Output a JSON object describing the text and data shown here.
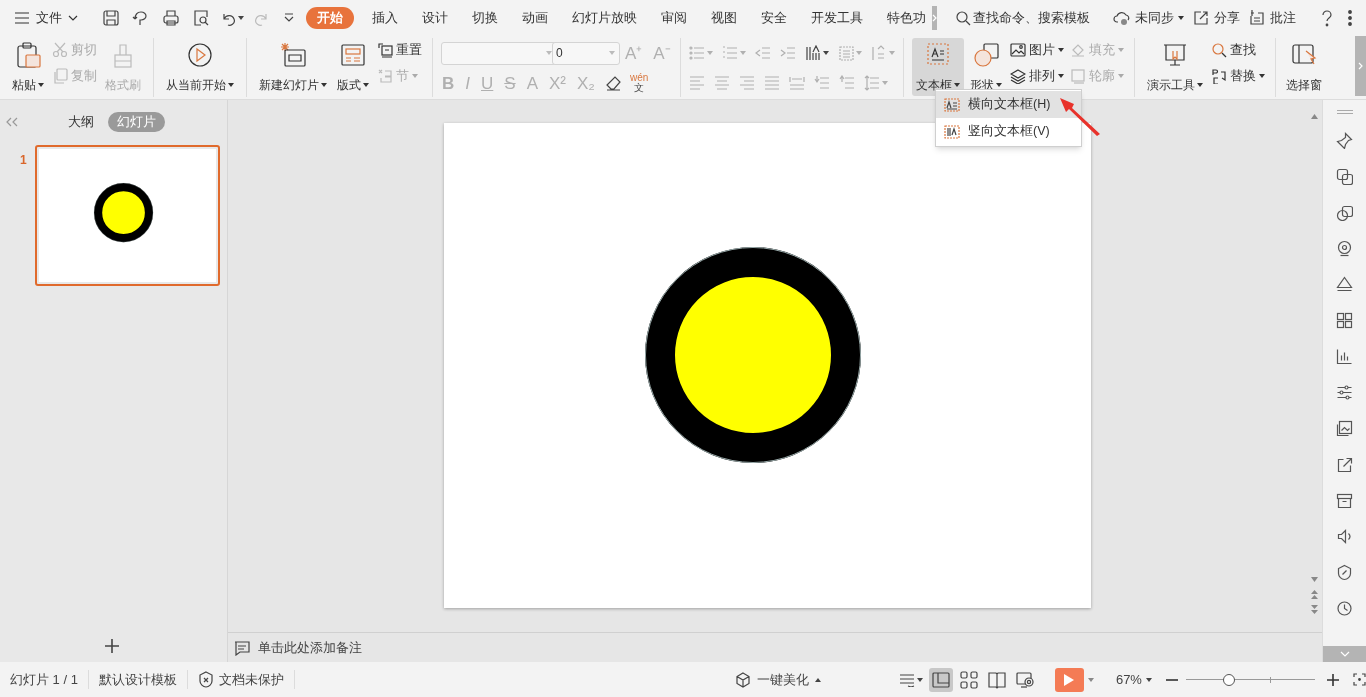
{
  "title_bar": {
    "file_menu": "文件",
    "tabs": [
      {
        "label": "开始",
        "selected": true
      },
      {
        "label": "插入",
        "selected": false
      },
      {
        "label": "设计",
        "selected": false
      },
      {
        "label": "切换",
        "selected": false
      },
      {
        "label": "动画",
        "selected": false
      },
      {
        "label": "幻灯片放映",
        "selected": false
      },
      {
        "label": "审阅",
        "selected": false
      },
      {
        "label": "视图",
        "selected": false
      },
      {
        "label": "安全",
        "selected": false
      },
      {
        "label": "开发工具",
        "selected": false
      },
      {
        "label": "特色功",
        "selected": false
      }
    ],
    "search": {
      "placeholder": "查找命令、搜索模板"
    },
    "actions": [
      {
        "label": "未同步",
        "dropdown": true
      },
      {
        "label": "分享",
        "dropdown": false
      },
      {
        "label": "批注",
        "dropdown": false
      }
    ]
  },
  "ribbon": {
    "groups": [
      {
        "items": [
          {
            "kind": "large",
            "label": "粘贴",
            "dropdown": true,
            "disabled": false,
            "pressed": false
          },
          {
            "kind": "small",
            "label": "剪切",
            "dropdown": false,
            "disabled": true,
            "pressed": false
          },
          {
            "kind": "small",
            "label": "复制",
            "dropdown": false,
            "disabled": true,
            "pressed": false
          },
          {
            "kind": "large",
            "label": "格式刷",
            "dropdown": false,
            "disabled": true,
            "pressed": false
          }
        ]
      },
      {
        "items": [
          {
            "kind": "large",
            "label": "从当前开始",
            "dropdown": true,
            "disabled": false,
            "pressed": false
          }
        ]
      },
      {
        "items": [
          {
            "kind": "large",
            "label": "新建幻灯片",
            "dropdown": true,
            "disabled": false,
            "pressed": false
          },
          {
            "kind": "large",
            "label": "版式",
            "dropdown": true,
            "disabled": false,
            "pressed": false
          },
          {
            "kind": "small",
            "label": "重置",
            "dropdown": false,
            "disabled": false,
            "pressed": false
          },
          {
            "kind": "small",
            "label": "节",
            "dropdown": true,
            "disabled": true,
            "pressed": false
          }
        ]
      },
      {
        "top_line": [
          {
            "kind": "field"
          },
          {
            "kind": "field",
            "value": "0"
          },
          {
            "kind": "glyph",
            "label": "A⁺",
            "disabled": true
          },
          {
            "kind": "glyph",
            "label": "A⁻",
            "disabled": true
          }
        ],
        "bottom_line": [
          {
            "kind": "glyph",
            "label": "B",
            "disabled": true
          },
          {
            "kind": "glyph",
            "label": "I",
            "disabled": true
          },
          {
            "kind": "glyph",
            "label": "U",
            "disabled": true
          },
          {
            "kind": "glyph",
            "label": "S",
            "disabled": true
          },
          {
            "kind": "glyph",
            "label": "A",
            "disabled": true
          },
          {
            "kind": "glyph",
            "label": "X²",
            "disabled": true
          },
          {
            "kind": "glyph",
            "label": "X₂",
            "disabled": true
          },
          {
            "kind": "icon",
            "disabled": false
          },
          {
            "kind": "phonetic",
            "ruby": "wén",
            "base": "文",
            "disabled": false
          }
        ]
      },
      {
        "top_line": [
          {
            "kind": "icon",
            "disabled": true
          },
          {
            "kind": "icon",
            "disabled": true
          },
          {
            "kind": "icon",
            "disabled": true
          },
          {
            "kind": "icon",
            "disabled": true
          },
          {
            "kind": "icon",
            "disabled": false
          },
          {
            "kind": "icon",
            "disabled": true
          },
          {
            "kind": "icon",
            "disabled": true
          }
        ],
        "bottom_line": [
          {
            "kind": "icon",
            "disabled": true
          },
          {
            "kind": "icon",
            "disabled": true
          },
          {
            "kind": "icon",
            "disabled": true
          },
          {
            "kind": "icon",
            "disabled": true
          },
          {
            "kind": "icon",
            "disabled": true
          },
          {
            "kind": "icon",
            "disabled": true
          },
          {
            "kind": "icon",
            "disabled": true
          },
          {
            "kind": "icon",
            "disabled": true
          }
        ]
      },
      {
        "items": [
          {
            "kind": "large",
            "label": "文本框",
            "dropdown": true,
            "disabled": false,
            "pressed": true
          },
          {
            "kind": "large",
            "label": "形状",
            "dropdown": true,
            "disabled": false,
            "pressed": false
          },
          {
            "kind": "small",
            "label": "图片",
            "dropdown": true,
            "disabled": false,
            "pressed": false
          },
          {
            "kind": "small",
            "label": "排列",
            "dropdown": true,
            "disabled": false,
            "pressed": false
          },
          {
            "kind": "small",
            "label": "填充",
            "dropdown": true,
            "disabled": true,
            "pressed": false
          },
          {
            "kind": "small",
            "label": "轮廓",
            "dropdown": true,
            "disabled": true,
            "pressed": false
          }
        ]
      },
      {
        "items": [
          {
            "kind": "large",
            "label": "演示工具",
            "dropdown": true,
            "disabled": false,
            "pressed": false
          },
          {
            "kind": "small",
            "label": "查找",
            "dropdown": false,
            "disabled": false,
            "pressed": false
          },
          {
            "kind": "small",
            "label": "替换",
            "dropdown": true,
            "disabled": false,
            "pressed": false
          }
        ]
      },
      {
        "items": [
          {
            "kind": "large",
            "label": "选择窗",
            "dropdown": false,
            "disabled": false,
            "pressed": false
          }
        ]
      }
    ]
  },
  "text_box_menu": {
    "items": [
      {
        "label": "横向文本框(H)",
        "selected": true
      },
      {
        "label": "竖向文本框(V)",
        "selected": false
      }
    ]
  },
  "side_panel": {
    "tabs": [
      {
        "label": "大纲",
        "selected": false
      },
      {
        "label": "幻灯片",
        "selected": true
      }
    ],
    "slides": [
      {
        "number": "1",
        "selected": true
      }
    ]
  },
  "notes": {
    "placeholder": "单击此处添加备注"
  },
  "status_bar": {
    "slide_counter": "幻灯片 1 / 1",
    "template": "默认设计模板",
    "protection": "文档未保护",
    "beautify": "一键美化",
    "views": [
      {
        "selected": true
      },
      {
        "selected": false
      },
      {
        "selected": false
      },
      {
        "selected": false
      }
    ],
    "zoom": "67%",
    "zoom_slider": {
      "level": 0.33
    }
  }
}
